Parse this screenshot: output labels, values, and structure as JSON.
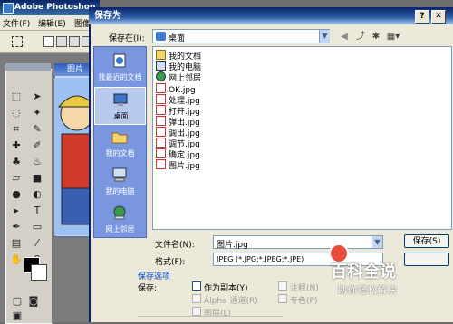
{
  "photoshop": {
    "title": "Adobe Photoshop",
    "menu": [
      "文件(F)",
      "编辑(E)",
      "图像"
    ],
    "doc_title": "图片"
  },
  "dialog": {
    "title": "保存为",
    "save_in_label": "保存在(I):",
    "save_in_value": "桌面",
    "places": [
      {
        "label": "我最近的文档",
        "icon": "recent-documents-icon"
      },
      {
        "label": "桌面",
        "icon": "desktop-icon",
        "selected": true
      },
      {
        "label": "我的文档",
        "icon": "my-documents-icon"
      },
      {
        "label": "我的电脑",
        "icon": "my-computer-icon"
      },
      {
        "label": "网上邻居",
        "icon": "network-places-icon"
      }
    ],
    "files": [
      {
        "name": "我的文档",
        "icon": "folder-icon"
      },
      {
        "name": "我的电脑",
        "icon": "computer-icon"
      },
      {
        "name": "网上邻居",
        "icon": "network-icon"
      },
      {
        "name": "OK.jpg",
        "icon": "jpg-file-icon"
      },
      {
        "name": "处理.jpg",
        "icon": "jpg-file-icon"
      },
      {
        "name": "打开.jpg",
        "icon": "jpg-file-icon"
      },
      {
        "name": "弹出.jpg",
        "icon": "jpg-file-icon"
      },
      {
        "name": "调出.jpg",
        "icon": "jpg-file-icon"
      },
      {
        "name": "调节.jpg",
        "icon": "jpg-file-icon"
      },
      {
        "name": "确定.jpg",
        "icon": "jpg-file-icon"
      },
      {
        "name": "图片.jpg",
        "icon": "jpg-file-icon"
      }
    ],
    "filename_label": "文件名(N):",
    "filename_value": "图片.jpg",
    "format_label": "格式(F):",
    "format_value": "JPEG (*.JPG;*.JPEG;*.JPE)",
    "save_button": "保存(S)",
    "options_title": "保存选项",
    "options_save_label": "保存:",
    "options": {
      "as_copy": "作为副本(Y)",
      "notes": "注释(N)",
      "alpha": "Alpha 通道(R)",
      "spot": "专色(P)",
      "layers": "图层(L)"
    }
  },
  "watermark": {
    "text": "百科全说",
    "subtitle": "助你轻松解决"
  }
}
